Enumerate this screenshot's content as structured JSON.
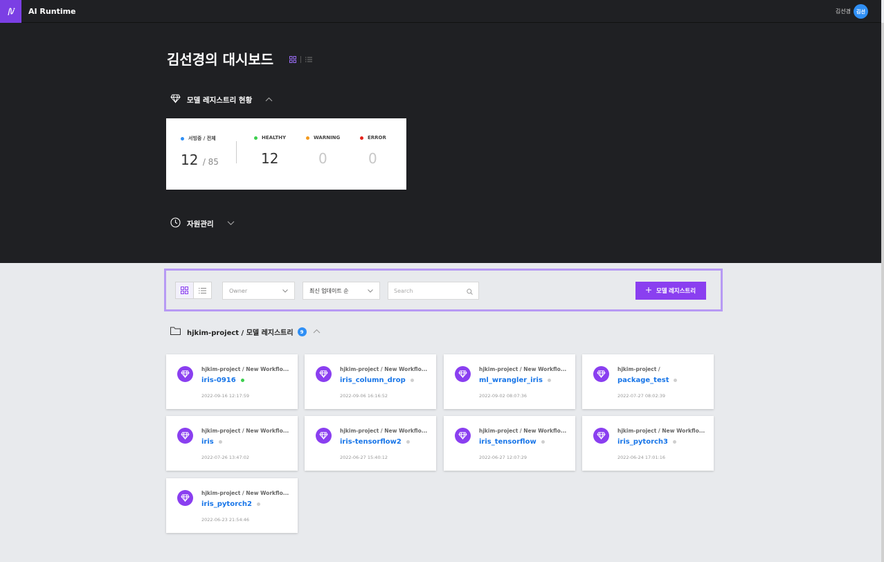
{
  "app": {
    "title": "AI Runtime",
    "user_name": "김선경",
    "user_avatar": "김선"
  },
  "dashboard": {
    "title": "김선경의 대시보드"
  },
  "registry_section": {
    "title": "모델 레지스트리 현황"
  },
  "stats": {
    "serving": {
      "label": "서빙중 / 전체",
      "value": "12",
      "total": "/ 85",
      "color": "#2f8ff5"
    },
    "healthy": {
      "label": "HEALTHY",
      "value": "12",
      "color": "#3ccf4e"
    },
    "warning": {
      "label": "WARNING",
      "value": "0",
      "color": "#f39a1e"
    },
    "error": {
      "label": "ERROR",
      "value": "0",
      "color": "#e5231b"
    }
  },
  "resource_section": {
    "title": "자원관리"
  },
  "toolbar": {
    "owner_placeholder": "Owner",
    "sort_value": "최신 업데이트 순",
    "search_placeholder": "Search",
    "add_label": "모델 레지스트리",
    "accent": "#8a3ff0"
  },
  "group": {
    "title": "hjkim-project / 모델 레지스트리",
    "count": "9"
  },
  "cards": [
    {
      "path": "hjkim-project / New Workflo...",
      "name": "iris-0916",
      "date": "2022-09-16 12:17:59",
      "status": "healthy"
    },
    {
      "path": "hjkim-project / New Workflo...",
      "name": "iris_column_drop",
      "date": "2022-09-06 16:16:52",
      "status": "idle"
    },
    {
      "path": "hjkim-project / New Workflo...",
      "name": "ml_wrangler_iris",
      "date": "2022-09-02 08:07:36",
      "status": "idle"
    },
    {
      "path": "hjkim-project /",
      "name": "package_test",
      "date": "2022-07-27 08:02:39",
      "status": "idle"
    },
    {
      "path": "hjkim-project / New Workflo...",
      "name": "iris",
      "date": "2022-07-26 13:47:02",
      "status": "idle"
    },
    {
      "path": "hjkim-project / New Workflo...",
      "name": "iris-tensorflow2",
      "date": "2022-06-27 15:40:12",
      "status": "idle"
    },
    {
      "path": "hjkim-project / New Workflo...",
      "name": "iris_tensorflow",
      "date": "2022-06-27 12:07:29",
      "status": "idle"
    },
    {
      "path": "hjkim-project / New Workflo...",
      "name": "iris_pytorch3",
      "date": "2022-06-24 17:01:16",
      "status": "idle"
    },
    {
      "path": "hjkim-project / New Workflo...",
      "name": "iris_pytorch2",
      "date": "2022-06-23 21:54:46",
      "status": "idle"
    }
  ],
  "status_colors": {
    "healthy": "#3ccf4e",
    "idle": "#cfcfcf"
  }
}
